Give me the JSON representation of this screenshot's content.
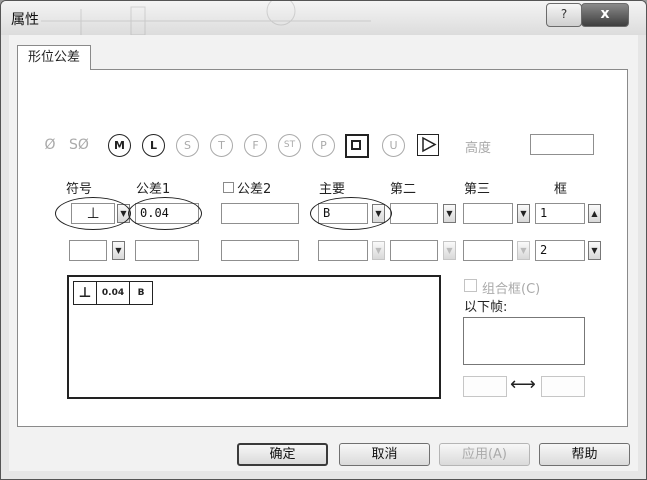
{
  "window": {
    "title": "属性",
    "help_label": "?",
    "close_label": "x"
  },
  "tabs": [
    {
      "label": "形位公差"
    }
  ],
  "symbol_row": {
    "diameter": "Ø",
    "spherical_diameter": "SØ",
    "modifiers": [
      "M",
      "L",
      "S",
      "T",
      "F",
      "ST",
      "P",
      "U"
    ],
    "height_label": "高度",
    "height_value": ""
  },
  "columns": {
    "symbol": "符号",
    "tolerance1": "公差1",
    "tolerance2": "公差2",
    "primary": "主要",
    "secondary": "第二",
    "tertiary": "第三",
    "frame": "框"
  },
  "rows": [
    {
      "symbol": "⊥",
      "tolerance1": "0.04",
      "tolerance2": "",
      "primary": "B",
      "secondary": "",
      "tertiary": "",
      "frame": "1"
    },
    {
      "symbol": "",
      "tolerance1": "",
      "tolerance2": "",
      "primary": "",
      "secondary": "",
      "tertiary": "",
      "frame": "2"
    }
  ],
  "preview": {
    "symbol": "⊥",
    "tolerance": "0.04",
    "datum": "B"
  },
  "composite": {
    "label": "组合框(C)",
    "below_frames_label": "以下帧:",
    "arrow": "⟷"
  },
  "buttons": {
    "ok": "确定",
    "cancel": "取消",
    "apply": "应用(A)",
    "help": "帮助"
  }
}
